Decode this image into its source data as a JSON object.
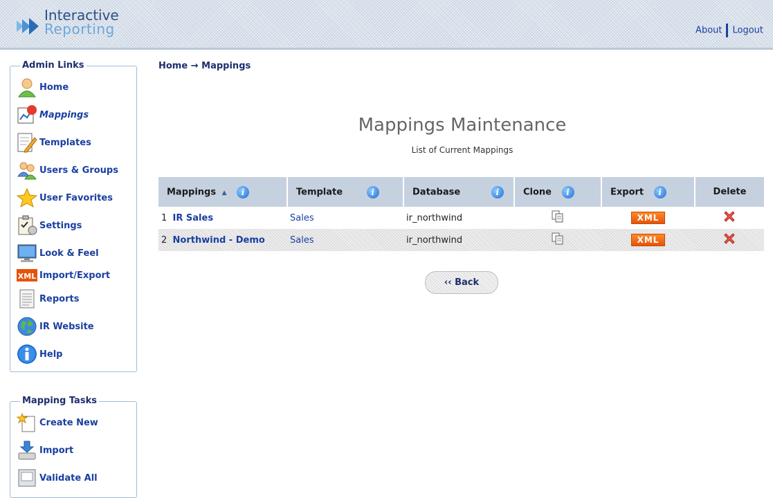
{
  "header": {
    "logo_line1": "Interactive",
    "logo_line2": "Reporting",
    "about_label": "About",
    "logout_label": "Logout"
  },
  "sidebar": {
    "admin_title": "Admin Links",
    "admin_items": [
      {
        "label": "Home",
        "icon": "user-icon"
      },
      {
        "label": "Mappings",
        "icon": "mappings-chart-icon",
        "active": true
      },
      {
        "label": "Templates",
        "icon": "template-edit-icon"
      },
      {
        "label": "Users & Groups",
        "icon": "users-groups-icon"
      },
      {
        "label": "User Favorites",
        "icon": "star-icon"
      },
      {
        "label": "Settings",
        "icon": "settings-clipboard-icon"
      },
      {
        "label": "Look & Feel",
        "icon": "monitor-icon"
      },
      {
        "label": "Import/Export",
        "icon": "xml-icon"
      },
      {
        "label": "Reports",
        "icon": "report-document-icon"
      },
      {
        "label": "IR Website",
        "icon": "globe-icon"
      },
      {
        "label": "Help",
        "icon": "info-icon"
      }
    ],
    "tasks_title": "Mapping Tasks",
    "task_items": [
      {
        "label": "Create New",
        "icon": "create-new-icon"
      },
      {
        "label": "Import",
        "icon": "import-icon"
      },
      {
        "label": "Validate All",
        "icon": "validate-icon"
      }
    ]
  },
  "breadcrumb": {
    "home": "Home",
    "arrow": "→",
    "current": "Mappings"
  },
  "main": {
    "title": "Mappings Maintenance",
    "subtitle": "List of Current Mappings",
    "columns": {
      "mappings": "Mappings",
      "template": "Template",
      "database": "Database",
      "clone": "Clone",
      "export": "Export",
      "delete": "Delete"
    },
    "rows": [
      {
        "num": "1",
        "name": "IR Sales",
        "template": "Sales",
        "database": "ir_northwind",
        "export": "XML"
      },
      {
        "num": "2",
        "name": "Northwind - Demo",
        "template": "Sales",
        "database": "ir_northwind",
        "export": "XML"
      }
    ],
    "back_label": "‹‹ Back"
  },
  "colors": {
    "accent": "#1a3fa0",
    "header_row": "#c6d1df",
    "export_orange": "#e5530a",
    "delete_red": "#e0443a"
  }
}
